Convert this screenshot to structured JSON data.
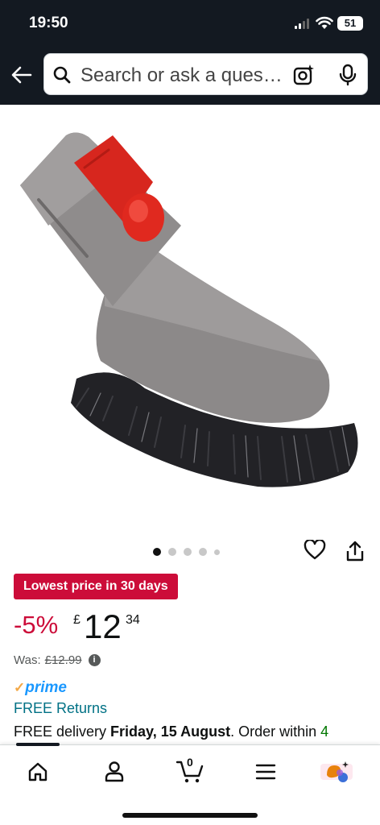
{
  "status_bar": {
    "time": "19:50",
    "battery": "51",
    "icons": [
      "signal-icon",
      "wifi-icon",
      "battery-icon"
    ]
  },
  "search": {
    "placeholder": "Search or ask a question",
    "icons": [
      "back-arrow-icon",
      "search-icon",
      "camera-icon",
      "mic-icon"
    ]
  },
  "product": {
    "image_alt": "Grey brush vacuum attachment with red release button and black bristles",
    "carousel": {
      "count": 5,
      "active_index": 0
    },
    "badge": "Lowest price in 30 days",
    "discount": "-5%",
    "price_symbol": "£",
    "price_whole": "12",
    "price_fraction": "34",
    "was_label": "Was:",
    "was_price": "£12.99",
    "prime_label": "prime",
    "returns": "FREE Returns",
    "delivery_prefix": "FREE delivery ",
    "delivery_date": "Friday, 15 August",
    "delivery_suffix": ". Order within ",
    "delivery_countdown": "4"
  },
  "bottom_nav": {
    "items": [
      "home-icon",
      "account-icon",
      "cart-icon",
      "menu-icon",
      "rufus-icon"
    ],
    "cart_count": "0"
  },
  "colors": {
    "header_bg": "#131921",
    "badge_red": "#cc0c39",
    "link_teal": "#007185",
    "prime_blue": "#1a98ff",
    "prime_check": "#f3a847"
  }
}
